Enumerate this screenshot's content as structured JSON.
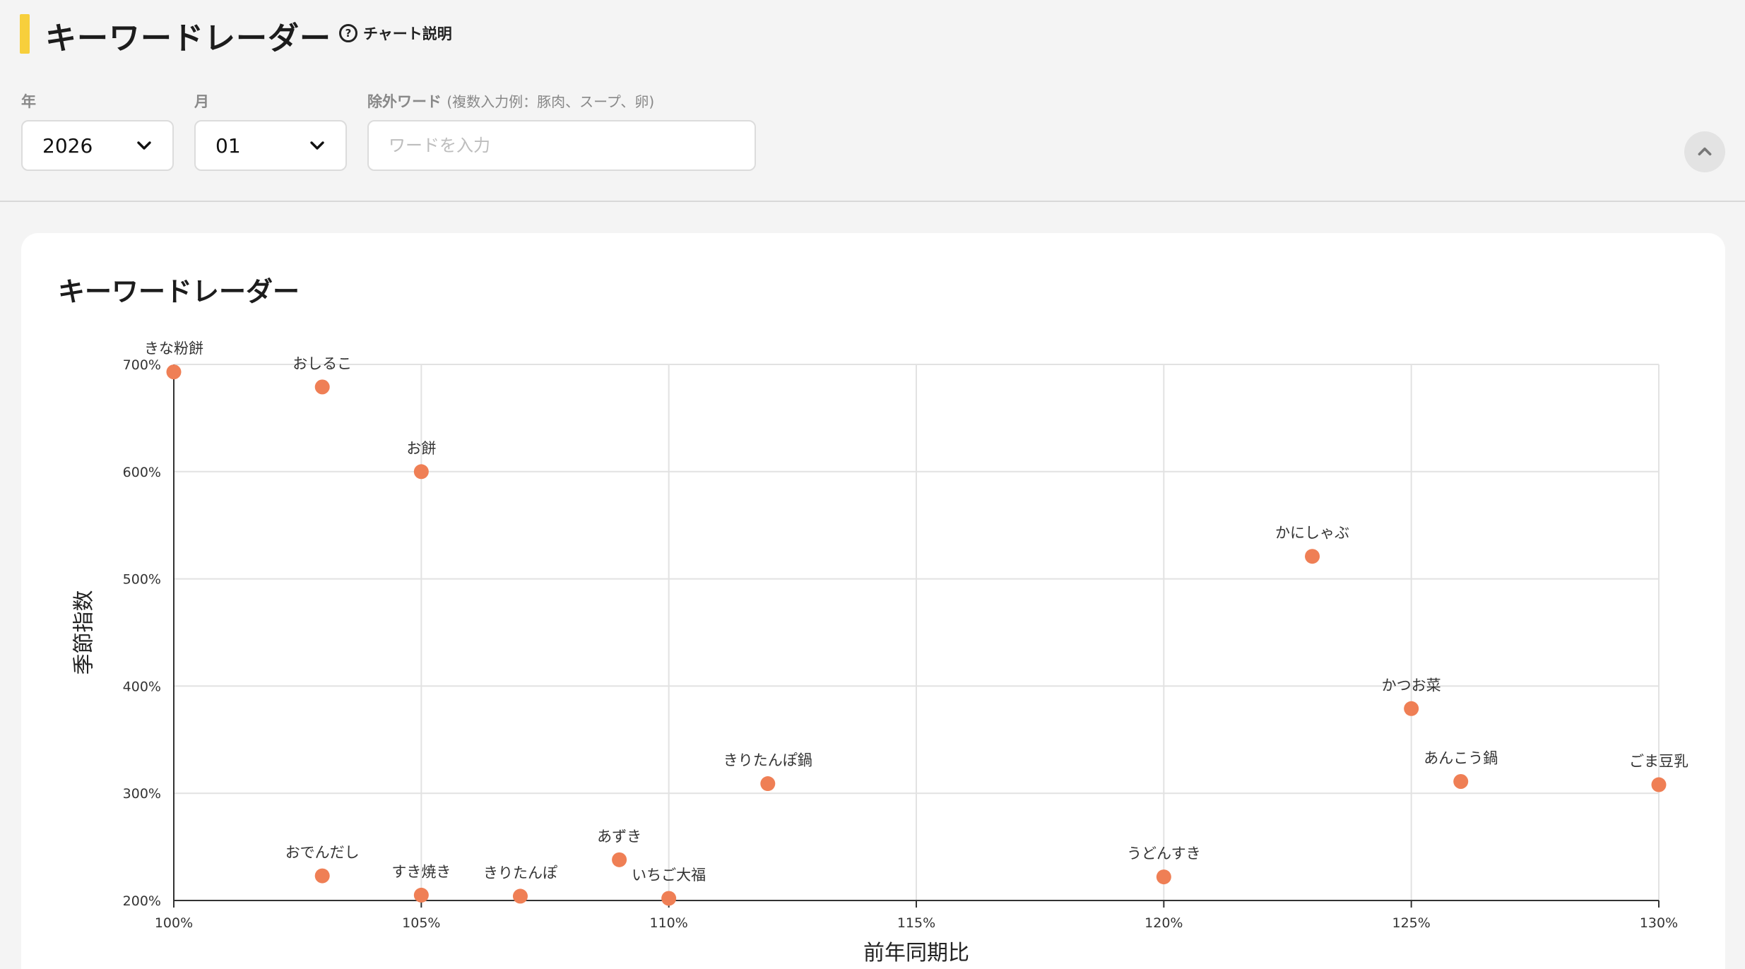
{
  "header": {
    "title": "キーワードレーダー",
    "help_label": "チャート説明",
    "help_icon": "question-circle-icon",
    "accent_color": "#f7cf3c"
  },
  "filters": {
    "year": {
      "label": "年",
      "value": "2026"
    },
    "month": {
      "label": "月",
      "value": "01"
    },
    "exclude": {
      "label": "除外ワード",
      "hint": "(複数入力例：豚肉、スープ、卵)",
      "placeholder": "ワードを入力",
      "value": ""
    },
    "collapse_icon": "chevron-up-icon"
  },
  "card": {
    "title": "キーワードレーダー"
  },
  "chart_data": {
    "type": "scatter",
    "title": "",
    "xlabel": "前年同期比",
    "ylabel": "季節指数",
    "xlim": [
      100,
      130
    ],
    "ylim": [
      200,
      700
    ],
    "x_ticks": [
      100,
      105,
      110,
      115,
      120,
      125,
      130
    ],
    "y_ticks": [
      200,
      300,
      400,
      500,
      600,
      700
    ],
    "tick_suffix": "%",
    "grid": true,
    "marker_color": "#ef7f55",
    "points": [
      {
        "label": "きな粉餅",
        "x": 100,
        "y": 693
      },
      {
        "label": "おしるこ",
        "x": 103,
        "y": 679
      },
      {
        "label": "お餅",
        "x": 105,
        "y": 600
      },
      {
        "label": "かにしゃぶ",
        "x": 123,
        "y": 521
      },
      {
        "label": "かつお菜",
        "x": 125,
        "y": 379
      },
      {
        "label": "あんこう鍋",
        "x": 126,
        "y": 311
      },
      {
        "label": "ごま豆乳",
        "x": 130,
        "y": 308
      },
      {
        "label": "きりたんぽ鍋",
        "x": 112,
        "y": 309
      },
      {
        "label": "あずき",
        "x": 109,
        "y": 238
      },
      {
        "label": "おでんだし",
        "x": 103,
        "y": 223
      },
      {
        "label": "すき焼き",
        "x": 105,
        "y": 205
      },
      {
        "label": "きりたんぽ",
        "x": 107,
        "y": 204
      },
      {
        "label": "いちご大福",
        "x": 110,
        "y": 202
      },
      {
        "label": "うどんすき",
        "x": 120,
        "y": 222
      }
    ]
  }
}
